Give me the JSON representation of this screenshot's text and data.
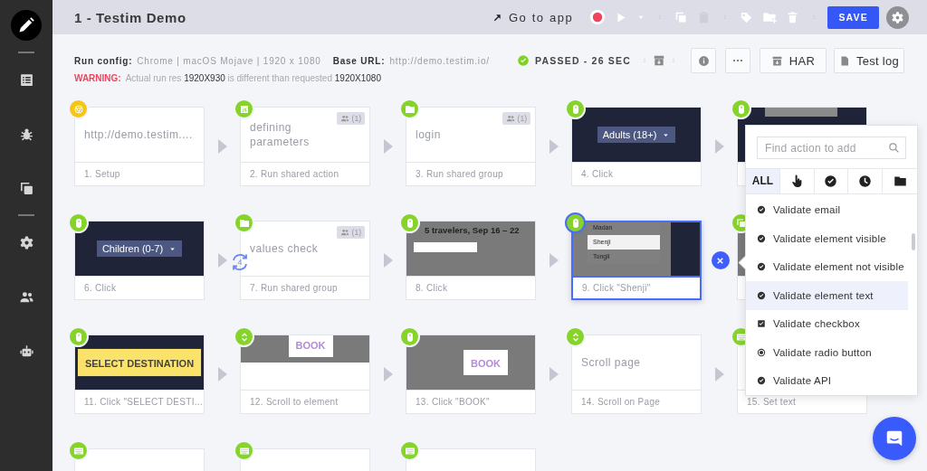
{
  "sidebar": {
    "items": [
      {
        "kind": "edit",
        "selected": true
      },
      {
        "kind": "divider",
        "selected": false
      },
      {
        "kind": "list",
        "selected": false
      },
      {
        "kind": "bug",
        "selected": false
      },
      {
        "kind": "copy",
        "selected": false
      },
      {
        "kind": "divider",
        "selected": false
      },
      {
        "kind": "settings",
        "selected": false
      },
      {
        "kind": "people",
        "selected": false
      },
      {
        "kind": "robot",
        "selected": false
      }
    ]
  },
  "header": {
    "title": "1 - Testim Demo",
    "go_to_app": "Go to app",
    "tool_groups": [
      {
        "tools": [
          {
            "kind": "record",
            "disabled": false
          },
          {
            "kind": "play",
            "disabled": false
          },
          {
            "kind": "dropdown",
            "disabled": false
          }
        ]
      },
      {
        "tools": [
          {
            "kind": "copy",
            "disabled": false
          },
          {
            "kind": "paste",
            "disabled": true
          }
        ]
      },
      {
        "tools": [
          {
            "kind": "tag",
            "disabled": false
          },
          {
            "kind": "folder-add",
            "disabled": false
          },
          {
            "kind": "delete",
            "disabled": false
          }
        ]
      }
    ],
    "save": "SAVE"
  },
  "run": {
    "config_label": "Run config:",
    "config": "Chrome | macOS Mojave | 1920 x 1080",
    "base_url_label": "Base URL:",
    "base_url": "http://demo.testim.io/",
    "warning_label": "WARNING:",
    "warning": "Actual run res **1920X930** is different than requested **1920X1080**",
    "passed": true,
    "status": "PASSED - 26 SEC",
    "har": "HAR",
    "test_log": "Test log"
  },
  "flow": {
    "rows": [
      {
        "steps": [
          {
            "kind": "setup",
            "text": "http://demo.testim....",
            "label": "1. Setup",
            "selected": false
          },
          {
            "kind": "js",
            "text": "defining parameters",
            "shared": "(1)",
            "label": "2. Run shared action",
            "selected": false
          },
          {
            "kind": "folder",
            "text": "login",
            "shared": "(1)",
            "label": "3. Run shared group",
            "selected": false
          },
          {
            "kind": "click",
            "preview": {
              "kind": "dark-select",
              "texts": [
                "Adults (18+)"
              ]
            },
            "label": "4. Click",
            "selected": false
          },
          {
            "kind": "click",
            "preview": {
              "kind": "dark-banner"
            },
            "selected": false
          }
        ]
      },
      {
        "steps": [
          {
            "kind": "click",
            "preview": {
              "kind": "dark-select",
              "texts": [
                "Children (0-7)"
              ]
            },
            "label": "6. Click",
            "selected": false
          },
          {
            "kind": "folder",
            "text": "values check",
            "shared": "(1)",
            "loop": "4",
            "label": "7. Run shared group",
            "selected": false
          },
          {
            "kind": "click",
            "preview": {
              "kind": "gray-search",
              "texts": [
                "5 travelers, Sep 16 – 22"
              ]
            },
            "label": "8. Click",
            "selected": false
          },
          {
            "kind": "click",
            "preview": {
              "kind": "gray-list",
              "texts": [
                "Madan",
                "Shenji",
                "Tongli"
              ]
            },
            "label": "9. Click \"Shenji\"",
            "selected": true
          },
          {
            "kind": "copy",
            "preview": {
              "kind": "gray-blank"
            },
            "selected": false
          }
        ]
      },
      {
        "steps": [
          {
            "kind": "click",
            "preview": {
              "kind": "yellow-button",
              "texts": [
                "SELECT DESTINATION"
              ]
            },
            "label": "11. Click \"SELECT DESTI...",
            "selected": false
          },
          {
            "kind": "scroll",
            "preview": {
              "kind": "gray-book-top",
              "texts": [
                "BOOK"
              ]
            },
            "label": "12. Scroll to element",
            "selected": false
          },
          {
            "kind": "click",
            "preview": {
              "kind": "gray-book",
              "texts": [
                "BOOK"
              ]
            },
            "label": "13. Click \"BOOK\"",
            "selected": false
          },
          {
            "kind": "scroll",
            "text": "Scroll page",
            "label": "14. Scroll on Page",
            "selected": false
          },
          {
            "kind": "keyboard",
            "label": "15. Set text",
            "selected": false
          }
        ]
      },
      {
        "steps": [
          {
            "kind": "keyboard",
            "selected": false
          },
          {
            "kind": "keyboard",
            "selected": false
          },
          {
            "kind": "keyboard",
            "selected": false
          }
        ]
      }
    ]
  },
  "picker": {
    "search": {
      "placeholder": "Find action to add"
    },
    "tabs": [
      {
        "kind": "text",
        "label": "ALL",
        "selected": true
      },
      {
        "kind": "pointer",
        "selected": false
      },
      {
        "kind": "validate",
        "selected": false
      },
      {
        "kind": "wait",
        "selected": false
      },
      {
        "kind": "folder",
        "selected": false
      }
    ],
    "items": [
      {
        "kind": "check",
        "label": "Validate email",
        "selected": false
      },
      {
        "kind": "check",
        "label": "Validate element visible",
        "selected": false
      },
      {
        "kind": "check",
        "label": "Validate element not visible",
        "selected": false
      },
      {
        "kind": "check",
        "label": "Validate element text",
        "selected": true
      },
      {
        "kind": "checkbox",
        "label": "Validate checkbox",
        "selected": false
      },
      {
        "kind": "radio",
        "label": "Validate radio button",
        "selected": false
      },
      {
        "kind": "check",
        "label": "Validate API",
        "selected": false
      }
    ]
  }
}
